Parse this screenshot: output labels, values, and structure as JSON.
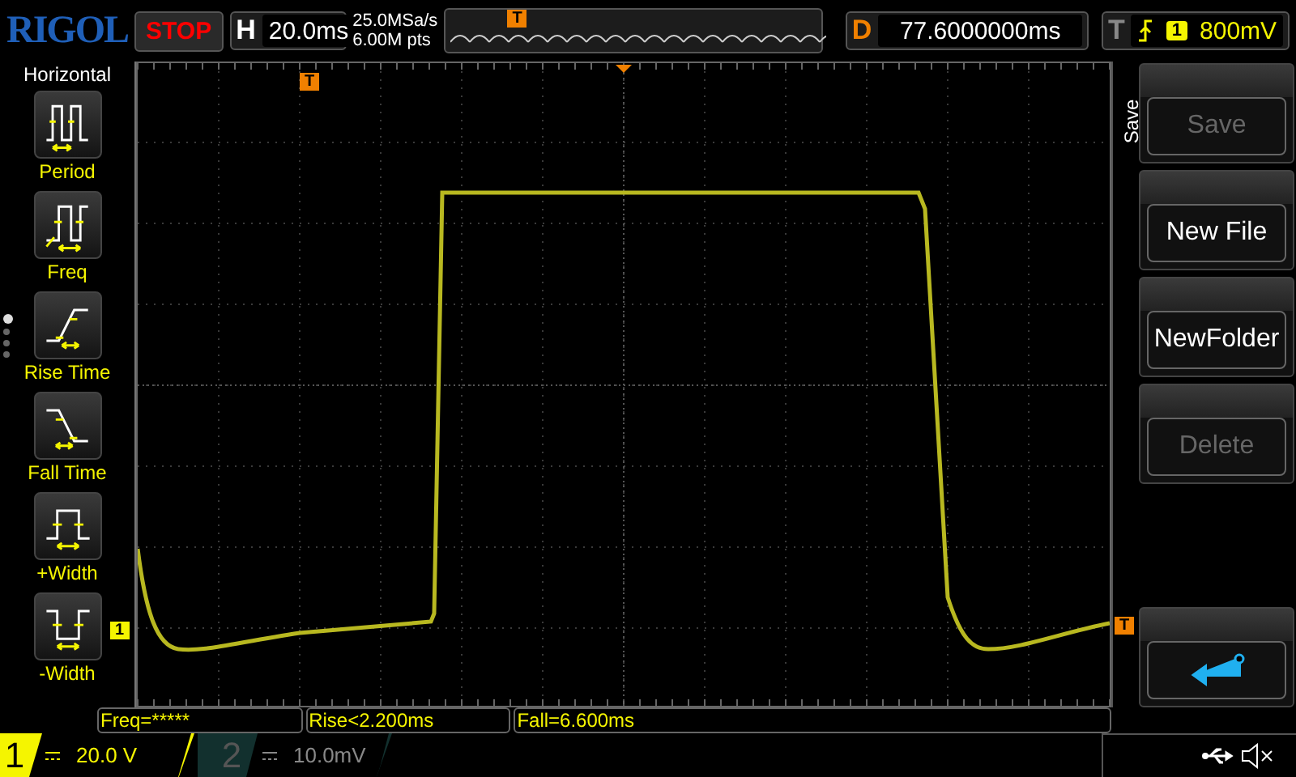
{
  "header": {
    "logo": "RIGOL",
    "run_state": "STOP",
    "horizontal": {
      "label": "H",
      "value": "20.0ms"
    },
    "sample_rate": "25.0MSa/s",
    "memory_depth": "6.00M pts",
    "delay": {
      "label": "D",
      "value": "77.6000000ms"
    },
    "trigger": {
      "label": "T",
      "source": "1",
      "level": "800mV"
    }
  },
  "left_menu": {
    "title": "Horizontal",
    "items": [
      {
        "label": "Period",
        "kind": "period"
      },
      {
        "label": "Freq",
        "kind": "freq"
      },
      {
        "label": "Rise Time",
        "kind": "rise"
      },
      {
        "label": "Fall Time",
        "kind": "fall"
      },
      {
        "label": "+Width",
        "kind": "pwidth"
      },
      {
        "label": "-Width",
        "kind": "nwidth"
      }
    ],
    "pages": [
      {
        "selected": true
      },
      {
        "selected": false
      },
      {
        "selected": false
      },
      {
        "selected": false
      }
    ]
  },
  "markers": {
    "overview_trigger": "T",
    "trigger_position": "T",
    "channel": "1",
    "trigger_level": "T"
  },
  "right_menu": {
    "title": "Save",
    "buttons": [
      {
        "kind": "text",
        "label": "Save",
        "disabled": true
      },
      {
        "kind": "text",
        "label": "New File",
        "disabled": false
      },
      {
        "kind": "text",
        "label": "NewFolder",
        "disabled": false
      },
      {
        "kind": "text",
        "label": "Delete",
        "disabled": true
      },
      {
        "kind": "back",
        "disabled": false
      }
    ]
  },
  "measurements": [
    "Freq=*****",
    "Rise<2.200ms",
    "Fall=6.600ms"
  ],
  "channels": [
    {
      "number": "1",
      "scale": "20.0 V",
      "active": true
    },
    {
      "number": "2",
      "scale": "10.0mV",
      "active": false
    }
  ]
}
